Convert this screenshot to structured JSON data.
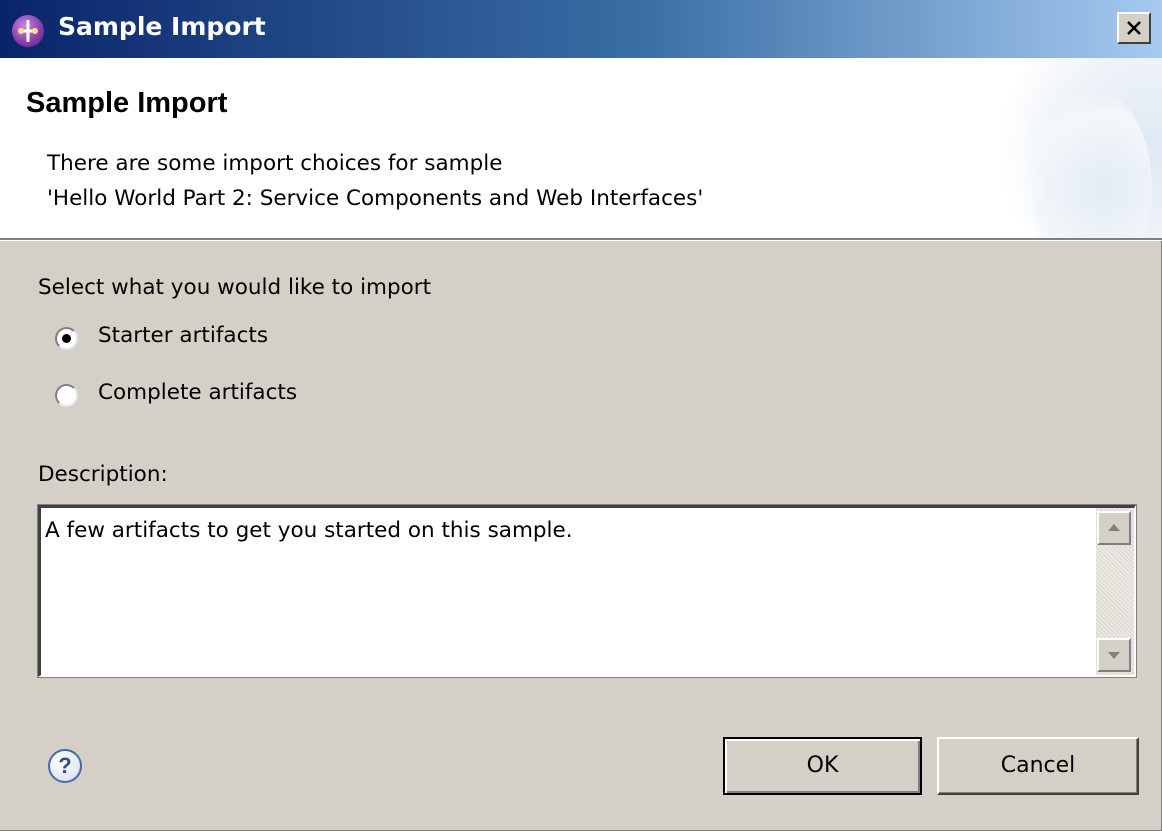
{
  "window": {
    "title": "Sample Import",
    "icon": "sample-import-app-icon",
    "close_icon": "close-x-icon"
  },
  "banner": {
    "title": "Sample Import",
    "description_line1": "There are some import choices for sample",
    "description_line2": "'Hello World Part 2: Service Components and Web Interfaces'"
  },
  "options": {
    "prompt": "Select what you would like to import",
    "items": [
      {
        "label": "Starter artifacts",
        "selected": true
      },
      {
        "label": "Complete artifacts",
        "selected": false
      }
    ]
  },
  "description": {
    "label": "Description:",
    "text": "A few artifacts to get you started on this sample."
  },
  "footer": {
    "help_icon": "question-help-icon",
    "help_glyph": "?",
    "ok_label": "OK",
    "cancel_label": "Cancel"
  },
  "colors": {
    "title_gradient_start": "#0a246a",
    "title_gradient_end": "#a6caf0",
    "dialog_background": "#d4d0c8"
  }
}
